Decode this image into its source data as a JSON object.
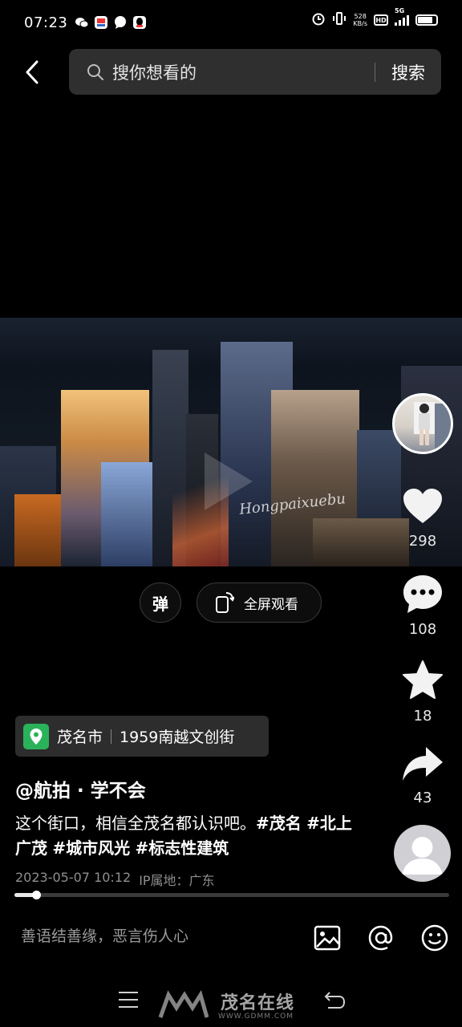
{
  "status_bar": {
    "time": "07:23",
    "net_speed_value": "528",
    "net_speed_unit": "KB/s",
    "hd_label": "HD",
    "network_type": "5G"
  },
  "header": {
    "search_placeholder": "搜你想看的",
    "search_button": "搜索"
  },
  "video": {
    "watermark": "Hongpaixuebu"
  },
  "right_rail": {
    "likes": "298",
    "comments": "108",
    "favorites": "18",
    "shares": "43"
  },
  "controls": {
    "danmaku_label": "弹",
    "fullscreen_label": "全屏观看"
  },
  "post": {
    "location_city": "茂名市",
    "location_place": "1959南越文创街",
    "author": "@航拍 · 学不会",
    "caption_text": "这个街口，相信全茂名都认识吧。",
    "hashtags": [
      "#茂名",
      "#北上广茂",
      "#城市风光",
      "#标志性建筑"
    ],
    "date": "2023-05-07 10:12",
    "ip_location": "IP属地：广东",
    "progress": 0.05
  },
  "comment_bar": {
    "placeholder": "善语结善缘，恶言伤人心"
  },
  "nav_watermark": {
    "site_name": "茂名在线",
    "site_url": "WWW.GDMM.COM"
  },
  "colors": {
    "background": "#000000",
    "search_bg": "#2f2f2f",
    "location_icon": "#2ab25a",
    "muted_text": "#8e8e8e"
  }
}
